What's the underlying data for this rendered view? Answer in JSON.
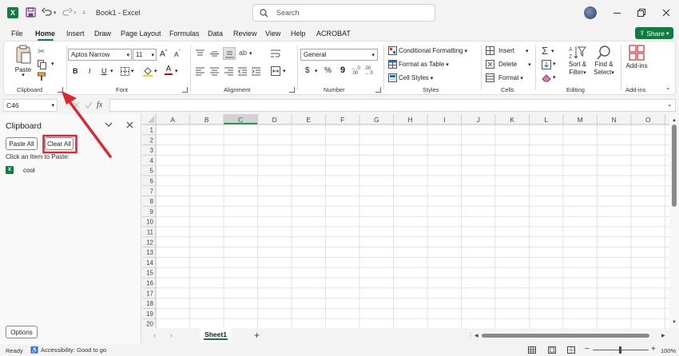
{
  "titlebar": {
    "title": "Book1  -  Excel",
    "search_placeholder": "Search"
  },
  "menu": {
    "items": [
      "File",
      "Home",
      "Insert",
      "Draw",
      "Page Layout",
      "Formulas",
      "Data",
      "Review",
      "View",
      "Help",
      "ACROBAT"
    ],
    "active": "Home",
    "share_label": "Share"
  },
  "ribbon": {
    "clipboard": {
      "paste": "Paste",
      "label": "Clipboard"
    },
    "font": {
      "name": "Aptos Narrow",
      "size": "11",
      "grow": "A",
      "shrink": "A",
      "bold": "B",
      "italic": "I",
      "underline": "U",
      "font_color_letter": "A",
      "label": "Font"
    },
    "alignment": {
      "label": "Alignment"
    },
    "number": {
      "format": "General",
      "currency": "$",
      "percent": "%",
      "comma": "9",
      "label": "Number"
    },
    "styles": {
      "conditional": "Conditional Formatting",
      "table": "Format as Table",
      "cell_styles": "Cell Styles",
      "label": "Styles"
    },
    "cells": {
      "insert": "Insert",
      "delete": "Delete",
      "format": "Format",
      "label": "Cells"
    },
    "editing": {
      "sort_1": "Sort &",
      "sort_2": "Filter",
      "find_1": "Find &",
      "find_2": "Select",
      "label": "Editing"
    },
    "addins": {
      "button": "Add-ins",
      "label": "Add-ins"
    }
  },
  "formula_bar": {
    "name_box": "C46",
    "fx": "fx",
    "value": ""
  },
  "clipboard_panel": {
    "title": "Clipboard",
    "paste_all": "Paste All",
    "clear_all": "Clear All",
    "hint": "Click an Item to Paste:",
    "items": [
      "cool"
    ],
    "options": "Options"
  },
  "grid": {
    "columns": [
      "A",
      "B",
      "C",
      "D",
      "E",
      "F",
      "G",
      "H",
      "I",
      "J",
      "K",
      "L",
      "M",
      "N",
      "O"
    ],
    "rows": [
      "1",
      "2",
      "3",
      "4",
      "5",
      "6",
      "7",
      "8",
      "9",
      "10",
      "11",
      "12",
      "13",
      "14",
      "15",
      "16",
      "17",
      "18",
      "19",
      "20"
    ],
    "selected_column": "C"
  },
  "sheets": {
    "tabs": [
      "Sheet1"
    ],
    "add": "+"
  },
  "status": {
    "ready": "Ready",
    "accessibility": "Accessibility: Good to go",
    "zoom": "100%",
    "minus": "−",
    "plus": "+"
  },
  "colors": {
    "excel_green": "#107c41",
    "accent": "#217346",
    "annotation": "#d9282f"
  }
}
